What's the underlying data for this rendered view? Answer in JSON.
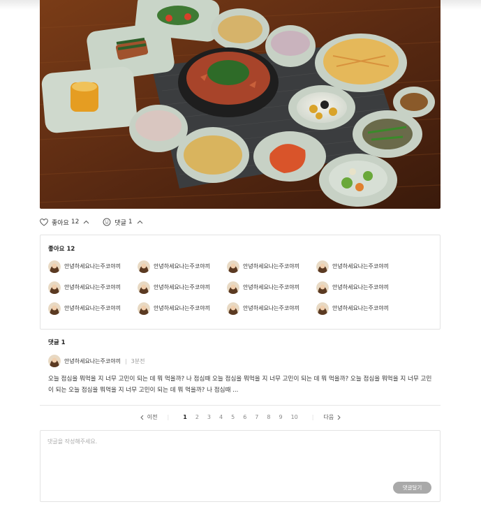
{
  "post": {
    "image_alt": "한정식 상차림"
  },
  "actions": {
    "like_label": "좋아요",
    "like_count": "12",
    "comment_label": "댓글",
    "comment_count": "1"
  },
  "likes": {
    "title": "좋아요",
    "count": "12",
    "users": [
      {
        "name": "안녕하세요나는주코야끼"
      },
      {
        "name": "안녕하세요나는주코야끼"
      },
      {
        "name": "안녕하세요나는주코야끼"
      },
      {
        "name": "안녕하세요나는주코야끼"
      },
      {
        "name": "안녕하세요나는주코야끼"
      },
      {
        "name": "안녕하세요나는주코야끼"
      },
      {
        "name": "안녕하세요나는주코야끼"
      },
      {
        "name": "안녕하세요나는주코야끼"
      },
      {
        "name": "안녕하세요나는주코야끼"
      },
      {
        "name": "안녕하세요나는주코야끼"
      },
      {
        "name": "안녕하세요나는주코야끼"
      },
      {
        "name": "안녕하세요나는주코야끼"
      }
    ]
  },
  "comments": {
    "title": "댓글",
    "count": "1",
    "items": [
      {
        "author": "안녕하세요나는주코야끼",
        "time": "3분전",
        "text": "오늘 점심을 뭐먹을 지 너무 고민이 되는 데 뭐 먹을까? 나 점심때 오늘 점심을 뭐먹을 지 너무 고민이 되는 데 뭐 먹을까? 오늘 점심을 뭐먹을 지 너무 고민이 되는 오늘 점심을 뭐먹을 지 너무 고민이 되는 데 뭐 먹을까? 나 점심때 ..."
      }
    ]
  },
  "pagination": {
    "prev_label": "이전",
    "next_label": "다음",
    "pages": [
      "1",
      "2",
      "3",
      "4",
      "5",
      "6",
      "7",
      "8",
      "9",
      "10"
    ],
    "current": "1"
  },
  "comment_form": {
    "placeholder": "댓글을 작성해주세요.",
    "value": "",
    "submit_label": "댓글달기"
  },
  "colors": {
    "table_wood": "#5a2a12",
    "accent_gray": "#a9a9a9"
  },
  "icons": {
    "like": "heart-outline-icon",
    "comment": "smile-bubble-icon",
    "expand": "chevron-up-icon",
    "prev": "chevron-left-icon",
    "next": "chevron-right-icon"
  }
}
